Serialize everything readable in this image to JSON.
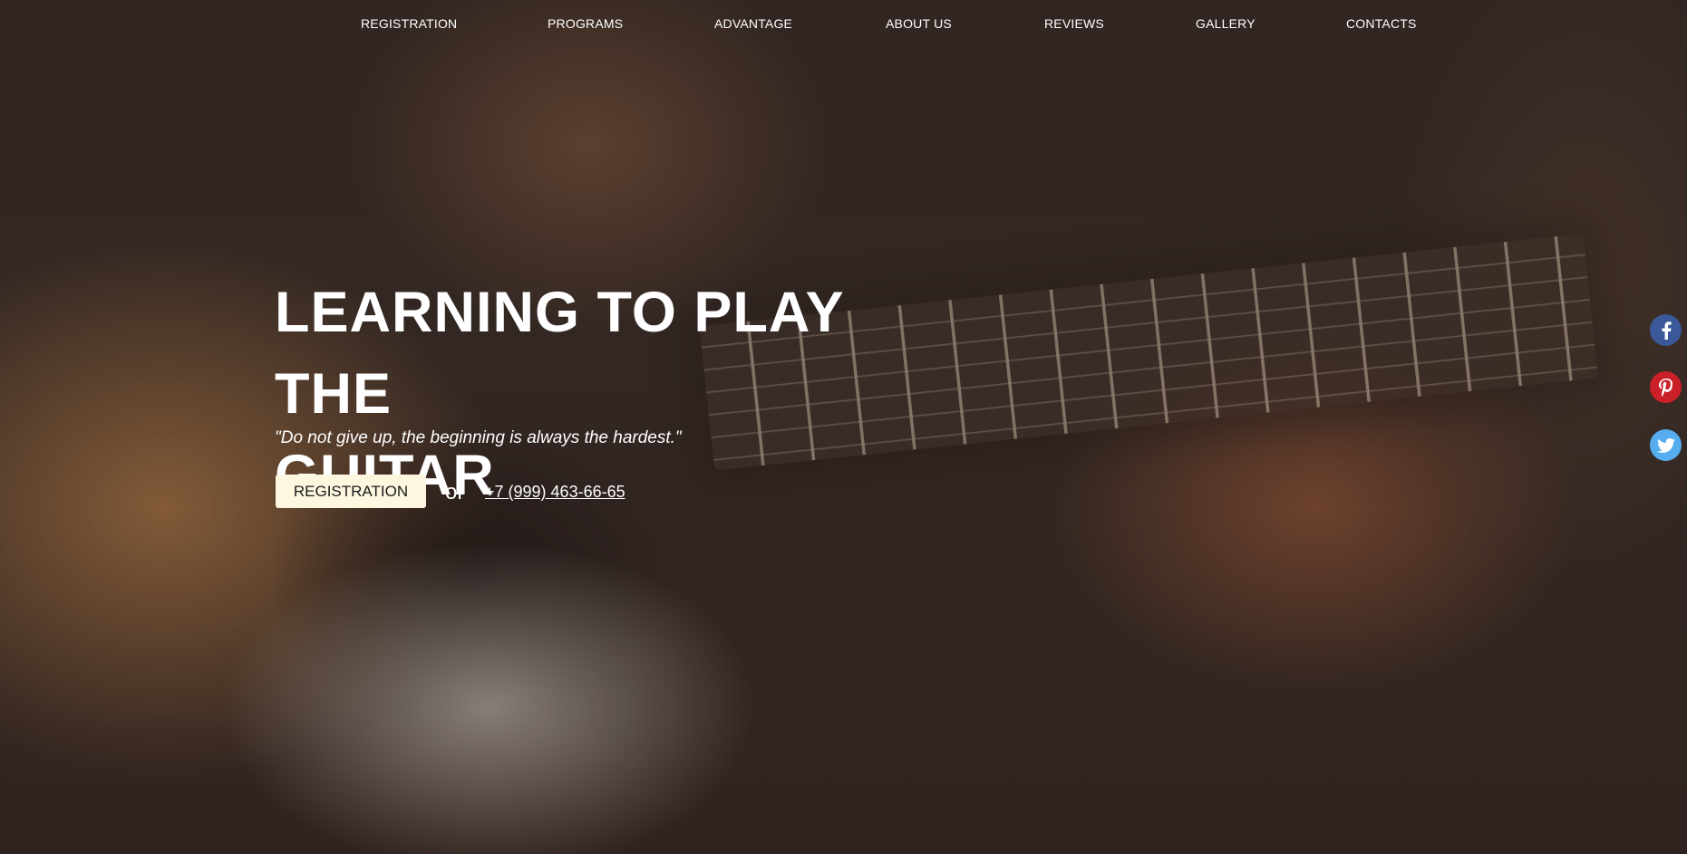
{
  "nav": {
    "items": [
      {
        "label": "REGISTRATION"
      },
      {
        "label": "PROGRAMS"
      },
      {
        "label": "ADVANTAGE"
      },
      {
        "label": "ABOUT US"
      },
      {
        "label": "REVIEWS"
      },
      {
        "label": "GALLERY"
      },
      {
        "label": "CONTACTS"
      }
    ]
  },
  "hero": {
    "headline_line1": "LEARNING TO PLAY THE",
    "headline_line2": "GUITAR",
    "quote": "\"Do not give up, the beginning is always the hardest.\"",
    "cta_label": "REGISTRATION",
    "or_text": "or",
    "phone": "+7 (999) 463-66-65"
  },
  "social": {
    "items": [
      {
        "icon": "facebook-icon",
        "color": "#3b5998"
      },
      {
        "icon": "pinterest-icon",
        "color": "#cb2027"
      },
      {
        "icon": "twitter-icon",
        "color": "#55acee"
      }
    ]
  },
  "colors": {
    "cta_background": "#fdf7df",
    "text": "#ffffff"
  }
}
